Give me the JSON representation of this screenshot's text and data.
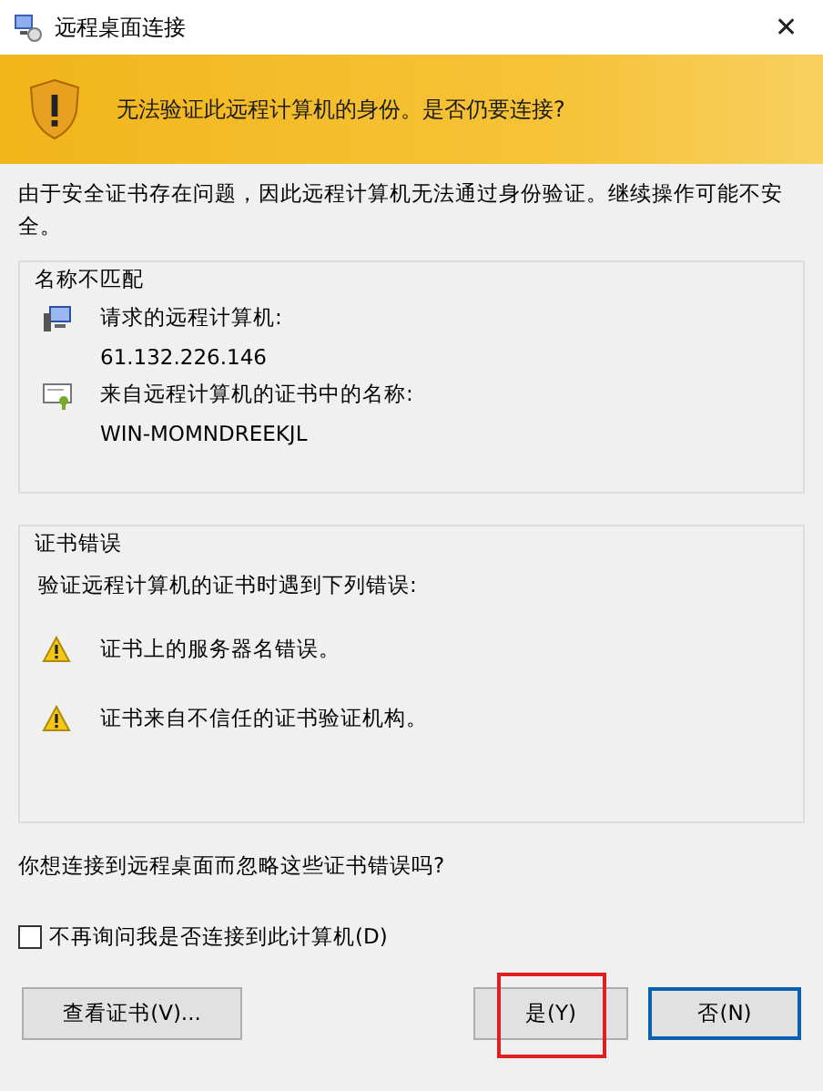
{
  "window": {
    "title": "远程桌面连接",
    "close": "✕"
  },
  "banner": {
    "text": "无法验证此远程计算机的身份。是否仍要连接?"
  },
  "description": "由于安全证书存在问题，因此远程计算机无法通过身份验证。继续操作可能不安全。",
  "groups": [
    {
      "title": "名称不匹配",
      "items": [
        {
          "kind": "computer",
          "label": "请求的远程计算机:",
          "value": "61.132.226.146"
        },
        {
          "kind": "certificate",
          "label": "来自远程计算机的证书中的名称:",
          "value": "WIN-MOMNDREEKJL"
        }
      ]
    },
    {
      "title": "证书错误",
      "intro": "验证远程计算机的证书时遇到下列错误:",
      "items": [
        {
          "kind": "warning",
          "label": "证书上的服务器名错误。"
        },
        {
          "kind": "warning",
          "label": "证书来自不信任的证书验证机构。"
        }
      ]
    }
  ],
  "question": "你想连接到远程桌面而忽略这些证书错误吗?",
  "checkbox": {
    "label": "不再询问我是否连接到此计算机(D)",
    "checked": false
  },
  "buttons": [
    {
      "label": "查看证书(V)...",
      "default": false,
      "highlighted": false
    },
    {
      "label": "是(Y)",
      "default": false,
      "highlighted": true
    },
    {
      "label": "否(N)",
      "default": true,
      "highlighted": false
    }
  ]
}
